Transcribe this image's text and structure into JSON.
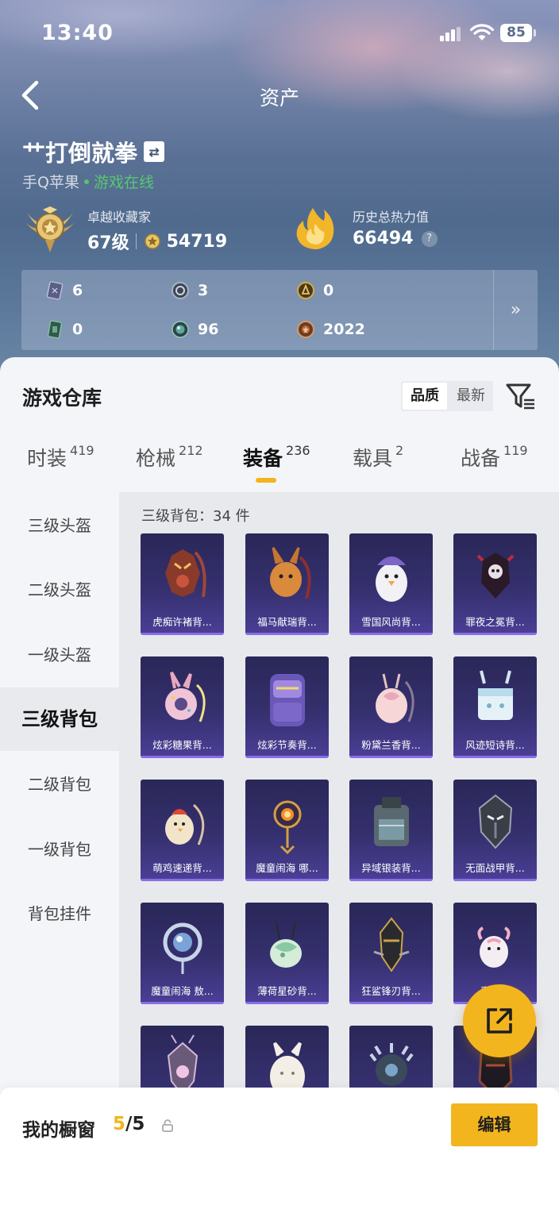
{
  "status_bar": {
    "time": "13:40",
    "battery": "85"
  },
  "header": {
    "title": "资产"
  },
  "profile": {
    "username": "艹打倒就拳",
    "platform": "手Q苹果",
    "online_status": "游戏在线",
    "collector_label": "卓越收藏家",
    "level": "67级",
    "coins": "54719",
    "heat_label": "历史总热力值",
    "heat_value": "66494",
    "help": "?"
  },
  "currencies": [
    {
      "icon": "card-icon",
      "value": "6"
    },
    {
      "icon": "silver-coin-icon",
      "value": "3"
    },
    {
      "icon": "gold-coin-icon",
      "value": "0"
    },
    {
      "icon": "green-card-icon",
      "value": "0"
    },
    {
      "icon": "gem-orb-icon",
      "value": "96"
    },
    {
      "icon": "bronze-coin-icon",
      "value": "2022"
    }
  ],
  "warehouse": {
    "title": "游戏仓库",
    "sort_options": [
      "品质",
      "最新"
    ],
    "active_sort": "品质"
  },
  "tabs": [
    {
      "label": "时装",
      "count": "419"
    },
    {
      "label": "枪械",
      "count": "212"
    },
    {
      "label": "装备",
      "count": "236",
      "active": true
    },
    {
      "label": "载具",
      "count": "2"
    },
    {
      "label": "战备",
      "count": "119"
    }
  ],
  "sidebar": [
    "三级头盔",
    "二级头盔",
    "一级头盔",
    "三级背包",
    "二级背包",
    "一级背包",
    "背包挂件"
  ],
  "active_sidebar": "三级背包",
  "category_count": "三级背包：34 件",
  "items": [
    {
      "name": "虎痴许褚背...",
      "art": "tiger-mask-backpack-icon"
    },
    {
      "name": "福马献瑞背...",
      "art": "horse-backpack-icon"
    },
    {
      "name": "雪国风尚背...",
      "art": "penguin-backpack-icon"
    },
    {
      "name": "罪夜之冕背...",
      "art": "skull-crown-backpack-icon"
    },
    {
      "name": "炫彩糖果背...",
      "art": "donut-backpack-icon"
    },
    {
      "name": "炫彩节奏背...",
      "art": "purple-backpack-icon"
    },
    {
      "name": "粉黛兰香背...",
      "art": "pink-flower-backpack-icon"
    },
    {
      "name": "风迹短诗背...",
      "art": "ice-block-backpack-icon"
    },
    {
      "name": "萌鸡速递背...",
      "art": "chick-backpack-icon"
    },
    {
      "name": "魔童闹海 哪...",
      "art": "golden-orb-backpack-icon"
    },
    {
      "name": "异域银装背...",
      "art": "tactical-backpack-icon"
    },
    {
      "name": "无面战甲背...",
      "art": "armor-backpack-icon"
    },
    {
      "name": "魔童闹海 敖...",
      "art": "silver-ring-backpack-icon"
    },
    {
      "name": "薄荷星砂背...",
      "art": "mint-backpack-icon"
    },
    {
      "name": "狂鲨锋刃背...",
      "art": "shark-blade-backpack-icon"
    },
    {
      "name": "喜羊...",
      "art": "sheep-backpack-icon"
    },
    {
      "name": "",
      "art": "ornate-backpack-icon"
    },
    {
      "name": "",
      "art": "white-bunny-backpack-icon"
    },
    {
      "name": "",
      "art": "spiky-backpack-icon"
    },
    {
      "name": "",
      "art": "dark-backpack-icon"
    }
  ],
  "showcase": {
    "label": "我的橱窗",
    "current": "5",
    "total": "/5",
    "edit_label": "编辑"
  },
  "colors": {
    "accent": "#f3b51e",
    "card_bg": "#35306e",
    "online": "#56c870"
  }
}
